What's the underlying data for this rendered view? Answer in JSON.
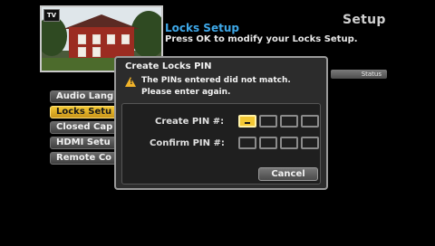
{
  "header": {
    "page_heading": "Setup",
    "title": "Locks Setup",
    "subtitle": "Press OK to modify your Locks Setup.",
    "status_label": "Status",
    "badge_text": "TV"
  },
  "menu": {
    "items": [
      {
        "label": "Audio Lang"
      },
      {
        "label": "Locks Setu"
      },
      {
        "label": "Closed Cap"
      },
      {
        "label": "HDMI Setu"
      },
      {
        "label": "Remote Co"
      }
    ],
    "selected_index": 1
  },
  "dialog": {
    "title": "Create Locks PIN",
    "warning_icon": "warning-icon",
    "message_line1": "The PINs entered did not match.",
    "message_line2": "Please enter again.",
    "create_label": "Create PIN #:",
    "confirm_label": "Confirm PIN #:",
    "cancel_label": "Cancel"
  },
  "colors": {
    "accent": "#f2c733",
    "title_blue": "#3ea8e8",
    "warning": "#f2b42a"
  }
}
